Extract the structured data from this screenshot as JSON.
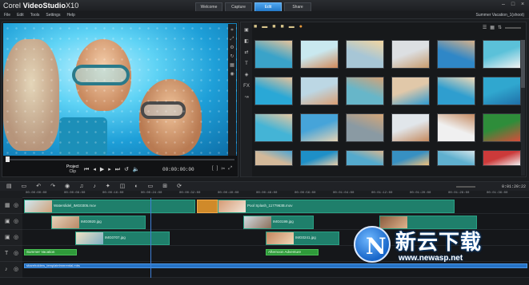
{
  "app": {
    "title_prefix": "Corel",
    "title_main": "VideoStudio",
    "title_version": "X10",
    "tabs": [
      {
        "label": "Welcome",
        "active": false
      },
      {
        "label": "Capture",
        "active": false
      },
      {
        "label": "Edit",
        "active": true
      },
      {
        "label": "Share",
        "active": false
      }
    ],
    "window_controls": [
      "minimize-icon",
      "maximize-icon",
      "close-icon"
    ]
  },
  "menubar": {
    "items": [
      "File",
      "Edit",
      "Tools",
      "Settings",
      "Help"
    ],
    "project_name": "Summer Vacation_1(shoot)"
  },
  "preview": {
    "mode_project": "Project",
    "mode_clip": "Clip",
    "timecode": "00:00:00:00",
    "controls": [
      "home-icon",
      "prev-frame-icon",
      "play-icon",
      "next-frame-icon",
      "end-icon",
      "repeat-icon",
      "volume-icon"
    ]
  },
  "library": {
    "toolbar_icons": [
      "folder-icon",
      "folder-open-icon",
      "folder-icon",
      "video-icon",
      "photo-icon",
      "audio-icon"
    ],
    "thumbnails": [
      {
        "c1": "#3aa3c9",
        "c2": "#e8c49a"
      },
      {
        "c1": "#c9e8ef",
        "c2": "#d18a5a"
      },
      {
        "c1": "#a7c6d6",
        "c2": "#f3d6a0"
      },
      {
        "c1": "#dcdfe2",
        "c2": "#c79b6d"
      },
      {
        "c1": "#2f87c7",
        "c2": "#d6b18a"
      },
      {
        "c1": "#5bc1d9",
        "c2": "#f2f2f2"
      },
      {
        "c1": "#2aa8d6",
        "c2": "#e7c199"
      },
      {
        "c1": "#bcd7e4",
        "c2": "#d99e73"
      },
      {
        "c1": "#67b6c9",
        "c2": "#d4a276"
      },
      {
        "c1": "#e1c8a9",
        "c2": "#2e9ad0"
      },
      {
        "c1": "#2f9ecf",
        "c2": "#f0d8b6"
      },
      {
        "c1": "#30a7cf",
        "c2": "#1f6fa8"
      },
      {
        "c1": "#44b4d6",
        "c2": "#e5c6a1"
      },
      {
        "c1": "#46a4d9",
        "c2": "#e6d3b4"
      },
      {
        "c1": "#8a9aa3",
        "c2": "#d5a677"
      },
      {
        "c1": "#e1e6ea",
        "c2": "#c48a5e"
      },
      {
        "c1": "#f0f0f0",
        "c2": "#c58a62"
      },
      {
        "c1": "#2e8d3a",
        "c2": "#d84c3a"
      },
      {
        "c1": "#d3b99a",
        "c2": "#4aa3d3"
      },
      {
        "c1": "#1e8fc7",
        "c2": "#e8cda8"
      },
      {
        "c1": "#54aacd",
        "c2": "#d8b790"
      },
      {
        "c1": "#3790c2",
        "c2": "#f0c07a"
      },
      {
        "c1": "#5fb0cf",
        "c2": "#d3e4ea"
      },
      {
        "c1": "#cc3a3a",
        "c2": "#f0f0f0"
      }
    ],
    "view_icons": [
      "list-view-icon",
      "thumbnail-view-icon",
      "sort-icon"
    ]
  },
  "timeline": {
    "toolbar_icons": [
      "storyboard-icon",
      "timeline-icon",
      "undo-icon",
      "redo-icon",
      "record-icon",
      "mixer-icon",
      "auto-music-icon",
      "motion-icon",
      "split-icon",
      "mask-icon",
      "subtitle-icon",
      "multicam-icon",
      "time-remap-icon"
    ],
    "timecode": "0:01:20:22",
    "ruler": [
      "00:00:00:00",
      "00:00:08:00",
      "00:00:16:00",
      "00:00:24:00",
      "00:00:32:00",
      "00:00:40:00",
      "00:00:48:00",
      "00:00:56:00",
      "00:01:04:00",
      "00:01:12:00",
      "00:01:20:00",
      "00:01:28:00",
      "00:01:36:00"
    ],
    "clips": {
      "video1": "Waterslidel_IMG0305.mov",
      "video2": "Pool Splash_1177963B.mov",
      "o1a": "IMG0920.jpg",
      "o1b": "IMG0199.jpg",
      "o2a": "IMG0707.jpg",
      "o2b": "IMG0241.jpg",
      "title1": "Summer Vacation",
      "title2": "Afternoon Adventure",
      "audio": "shareholders_templatelmmrental.mbs"
    }
  },
  "watermark": {
    "logo_text": "N",
    "brand": "新云下载",
    "url": "www.newasp.net"
  }
}
